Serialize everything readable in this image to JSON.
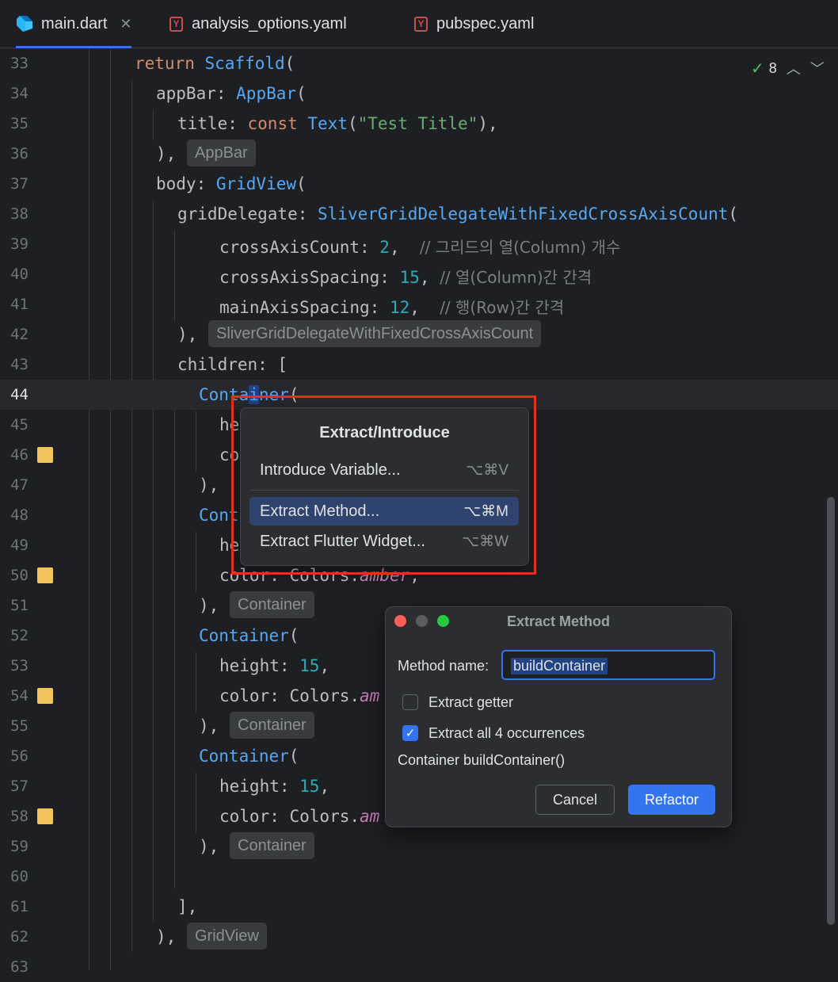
{
  "tabs": [
    {
      "label": "main.dart",
      "icon": "dart-icon",
      "active": true
    },
    {
      "label": "analysis_options.yaml",
      "icon": "yaml-icon",
      "badge": "Y"
    },
    {
      "label": "pubspec.yaml",
      "icon": "yaml-icon",
      "badge": "Y"
    }
  ],
  "inspections": {
    "count": "8"
  },
  "lines": {
    "l33": "33",
    "l34": "34",
    "l35": "35",
    "l36": "36",
    "l37": "37",
    "l38": "38",
    "l39": "39",
    "l40": "40",
    "l41": "41",
    "l42": "42",
    "l43": "43",
    "l44": "44",
    "l45": "45",
    "l46": "46",
    "l47": "47",
    "l48": "48",
    "l49": "49",
    "l50": "50",
    "l51": "51",
    "l52": "52",
    "l53": "53",
    "l54": "54",
    "l55": "55",
    "l56": "56",
    "l57": "57",
    "l58": "58",
    "l59": "59",
    "l60": "60",
    "l61": "61",
    "l62": "62",
    "l63": "63"
  },
  "code": {
    "return": "return",
    "scaffold": "Scaffold",
    "paren_open": "(",
    "appbar_key": "appBar: ",
    "appbar_cls": "AppBar",
    "title_key": "title: ",
    "const": "const",
    "text_cls": "Text",
    "test_title": "\"Test Title\"",
    "paren_close_comma": "),",
    "close_comma": "),",
    "body_key": "body: ",
    "gridview_cls": "GridView",
    "griddelegate_key": "gridDelegate: ",
    "sliver_cls": "SliverGridDelegateWithFixedCrossAxisCount",
    "cross_count_key": "crossAxisCount: ",
    "cross_count_val": "2",
    "comma": ",",
    "cross_count_comment": "// 그리드의 열(Column) 개수",
    "cross_spacing_key": "crossAxisSpacing: ",
    "cross_spacing_val": "15",
    "cross_spacing_comment": "// 열(Column)간 간격",
    "main_spacing_key": "mainAxisSpacing: ",
    "main_spacing_val": "12",
    "main_spacing_comment": "// 행(Row)간 간격",
    "children_key": "children: [",
    "container_a": "Conta",
    "container_i": "i",
    "container_b": "ner",
    "container_cls": "Container",
    "he": "he",
    "co": "co",
    "cont": "Cont",
    "color_partial_key": "color: Colors.",
    "amber": "amber",
    "height_key": "height: ",
    "height_val": "15",
    "color_key": "color: Colors.",
    "am": "am",
    "bracket_close": "],"
  },
  "hints": {
    "appbar": "AppBar",
    "sliver": "SliverGridDelegateWithFixedCrossAxisCount",
    "container": "Container",
    "gridview": "GridView"
  },
  "popup": {
    "title": "Extract/Introduce",
    "items": [
      {
        "label": "Introduce Variable...",
        "shortcut": "⌥⌘V"
      },
      {
        "label": "Extract Method...",
        "shortcut": "⌥⌘M",
        "selected": true
      },
      {
        "label": "Extract Flutter Widget...",
        "shortcut": "⌥⌘W"
      }
    ]
  },
  "dialog": {
    "title": "Extract Method",
    "method_name_label": "Method name:",
    "method_name_value": "buildContainer",
    "extract_getter_label": "Extract getter",
    "extract_getter_checked": false,
    "extract_all_label": "Extract all 4 occurrences",
    "extract_all_checked": true,
    "signature": "Container buildContainer()",
    "cancel_label": "Cancel",
    "refactor_label": "Refactor"
  },
  "colors": {
    "editor_bg": "#1e1f22",
    "keyword": "#cf8e6d",
    "class": "#56a8f5",
    "string": "#6aab73",
    "number": "#2aacb8",
    "comment": "#7a7e85",
    "field": "#c77dbb",
    "accent": "#3574f0",
    "highlight_box": "#e2301f",
    "gutter_marker": "#f2c55c"
  }
}
